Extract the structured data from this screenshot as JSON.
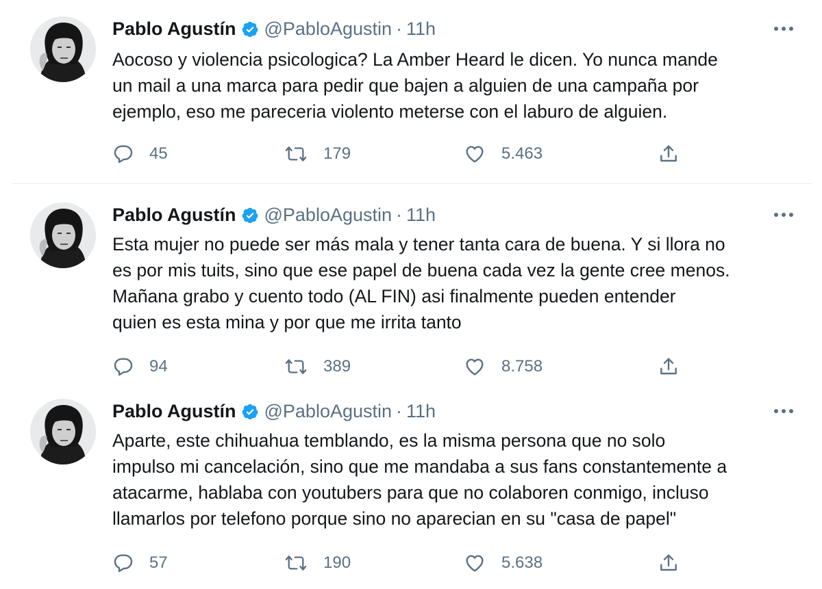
{
  "colors": {
    "verified": "#1da1f2",
    "muted": "#5b7083",
    "text": "#14171a",
    "divider": "#e6ecf0"
  },
  "icons": {
    "reply": "speech-bubble-icon",
    "retweet": "retweet-arrows-icon",
    "like": "heart-icon",
    "share": "share-upload-icon",
    "verified": "verified-badge-icon",
    "more": "more-dots-icon"
  },
  "tweets": [
    {
      "author_name": "Pablo Agustín",
      "handle": "@PabloAgustin",
      "separator": "·",
      "time": "11h",
      "lines": [
        "Aocoso y violencia psicologica? La Amber Heard le dicen. Yo nunca mande",
        "un mail a una marca para pedir que bajen a alguien de una campaña por",
        "ejemplo, eso me pareceria violento meterse con el laburo de alguien."
      ],
      "replies": "45",
      "retweets": "179",
      "likes": "5.463"
    },
    {
      "author_name": "Pablo Agustín",
      "handle": "@PabloAgustin",
      "separator": "·",
      "time": "11h",
      "lines": [
        "Esta mujer no puede ser más mala y tener tanta cara de buena. Y si llora no",
        "es por mis tuits, sino que ese papel de buena cada vez la gente cree menos.",
        "Mañana grabo y cuento todo (AL FIN) asi finalmente pueden entender",
        "quien es esta mina y por que me irrita tanto"
      ],
      "replies": "94",
      "retweets": "389",
      "likes": "8.758"
    },
    {
      "author_name": "Pablo Agustín",
      "handle": "@PabloAgustin",
      "separator": "·",
      "time": "11h",
      "lines": [
        "Aparte, este chihuahua temblando, es la misma persona que no solo",
        "impulso mi cancelación, sino que me mandaba a sus fans constantemente a",
        "atacarme, hablaba con youtubers para que no colaboren conmigo, incluso",
        "llamarlos por telefono porque sino no aparecian en su \"casa de papel\""
      ],
      "replies": "57",
      "retweets": "190",
      "likes": "5.638"
    }
  ]
}
